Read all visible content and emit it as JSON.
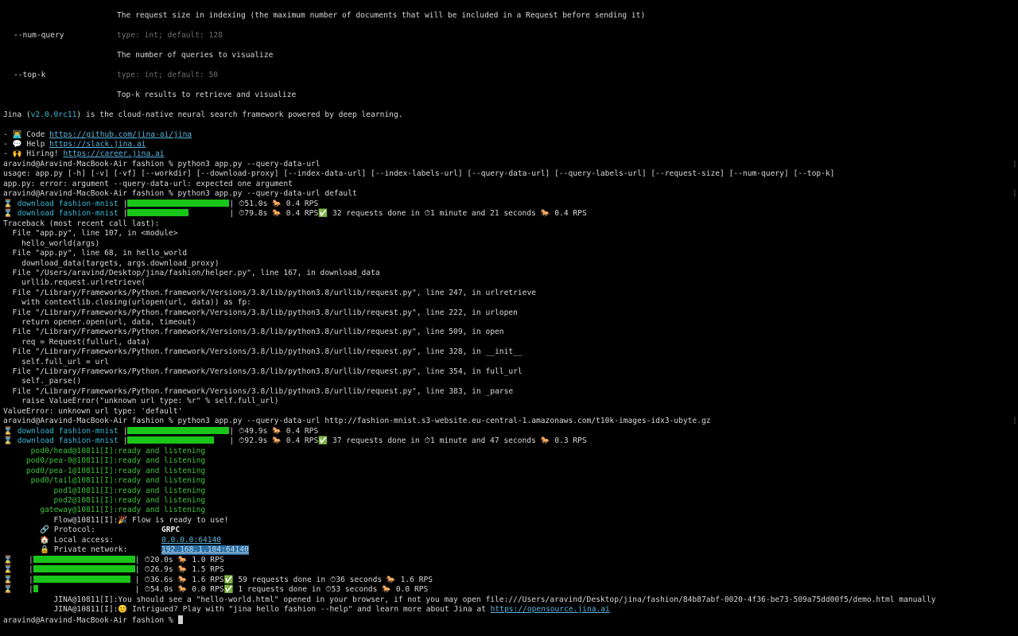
{
  "help": {
    "request_size_desc": "The request size in indexing (the maximum number of documents that will be included in a Request before sending it)",
    "num_query_flag": "--num-query",
    "num_query_type": "type: int; default: 128",
    "num_query_desc": "The number of queries to visualize",
    "top_k_flag": "--top-k",
    "top_k_type": "type: int; default: 50",
    "top_k_desc": "Top-k results to retrieve and visualize"
  },
  "banner": {
    "pre": "Jina (",
    "version": "v2.0.0rc11",
    "post": ") is the cloud-native neural search framework powered by deep learning.",
    "code_label": "- 👨‍💻 Code ",
    "code_url": "https://github.com/jina-ai/jina",
    "help_label": "- 💬 Help ",
    "help_url": "https://slack.jina.ai",
    "hiring_label": "- 🙌 Hiring! ",
    "hiring_url": "https://career.jina.ai"
  },
  "run1": {
    "prompt": "aravind@Aravind-MacBook-Air fashion % python3 app.py --query-data-url",
    "usage": "usage: app.py [-h] [-v] [-vf] [--workdir] [--download-proxy] [--index-data-url] [--index-labels-url] [--query-data-url] [--query-labels-url] [--request-size] [--num-query] [--top-k]",
    "error": "app.py: error: argument --query-data-url: expected one argument"
  },
  "run2": {
    "prompt": "aravind@Aravind-MacBook-Air fashion % python3 app.py --query-data-url default",
    "dl1_label": "download fashion-mnist",
    "dl1_progress": 1.0,
    "dl1_stats": "⏱51.0s 🐎 0.4 RPS",
    "dl2_label": "download fashion-mnist",
    "dl2_progress": 0.6,
    "dl2_stats": "⏱79.8s 🐎 0.4 RPS✅ 32 requests done in ⏱1 minute and 21 seconds 🐎 0.4 RPS",
    "traceback": [
      "Traceback (most recent call last):",
      "  File \"app.py\", line 107, in <module>",
      "    hello_world(args)",
      "  File \"app.py\", line 68, in hello_world",
      "    download_data(targets, args.download_proxy)",
      "  File \"/Users/aravind/Desktop/jina/fashion/helper.py\", line 167, in download_data",
      "    urllib.request.urlretrieve(",
      "  File \"/Library/Frameworks/Python.framework/Versions/3.8/lib/python3.8/urllib/request.py\", line 247, in urlretrieve",
      "    with contextlib.closing(urlopen(url, data)) as fp:",
      "  File \"/Library/Frameworks/Python.framework/Versions/3.8/lib/python3.8/urllib/request.py\", line 222, in urlopen",
      "    return opener.open(url, data, timeout)",
      "  File \"/Library/Frameworks/Python.framework/Versions/3.8/lib/python3.8/urllib/request.py\", line 509, in open",
      "    req = Request(fullurl, data)",
      "  File \"/Library/Frameworks/Python.framework/Versions/3.8/lib/python3.8/urllib/request.py\", line 328, in __init__",
      "    self.full_url = url",
      "  File \"/Library/Frameworks/Python.framework/Versions/3.8/lib/python3.8/urllib/request.py\", line 354, in full_url",
      "    self._parse()",
      "  File \"/Library/Frameworks/Python.framework/Versions/3.8/lib/python3.8/urllib/request.py\", line 383, in _parse",
      "    raise ValueError(\"unknown url type: %r\" % self.full_url)",
      "ValueError: unknown url type: 'default'"
    ]
  },
  "run3": {
    "prompt": "aravind@Aravind-MacBook-Air fashion % python3 app.py --query-data-url http://fashion-mnist.s3-website.eu-central-1.amazonaws.com/t10k-images-idx3-ubyte.gz",
    "dl1_label": "download fashion-mnist",
    "dl1_progress": 1.0,
    "dl1_stats": "⏱49.9s 🐎 0.4 RPS",
    "dl2_label": "download fashion-mnist",
    "dl2_progress": 0.85,
    "dl2_stats": "⏱92.9s 🐎 0.4 RPS✅ 37 requests done in ⏱1 minute and 47 seconds 🐎 0.3 RPS",
    "pods": [
      "      pod0/head@10811[I]:ready and listening",
      "     pod0/pea-0@10811[I]:ready and listening",
      "     pod0/pea-1@10811[I]:ready and listening",
      "      pod0/tail@10811[I]:ready and listening",
      "           pod1@10811[I]:ready and listening",
      "           pod2@10811[I]:ready and listening",
      "        gateway@10811[I]:ready and listening"
    ],
    "flow_ready": "           Flow@10811[I]:🎉 Flow is ready to use!",
    "protocol_label": "        🔗 Protocol:",
    "protocol_value": "GRPC",
    "local_label": "        🏠 Local access:",
    "local_value": "0.0.0.0:64140",
    "private_label": "        🔒 Private network:",
    "private_value": "192.168.1.104:64140",
    "bars": [
      {
        "progress": 1.0,
        "stats": "⏱20.0s 🐎 1.0 RPS"
      },
      {
        "progress": 1.0,
        "stats": "⏱26.9s 🐎 1.5 RPS"
      },
      {
        "progress": 0.95,
        "stats": "⏱36.6s 🐎 1.6 RPS✅ 59 requests done in ⏱36 seconds 🐎 1.6 RPS"
      },
      {
        "progress": 0.05,
        "stats": "⏱54.0s 🐎 0.0 RPS✅ 1 requests done in ⏱53 seconds 🐎 0.0 RPS"
      }
    ],
    "jina_msg1": "           JINA@10811[I]:You should see a \"hello-world.html\" opened in your browser, if not you may open file:///Users/aravind/Desktop/jina/fashion/84b87abf-0020-4f36-be73-509a75dd00f5/demo.html manually",
    "jina_msg2_pre": "           JINA@10811[I]:😊 Intrigued? Play with \"jina hello fashion --help\" and learn more about Jina at ",
    "jina_msg2_url": "https://opensource.jina.ai"
  },
  "final_prompt": "aravind@Aravind-MacBook-Air fashion % "
}
